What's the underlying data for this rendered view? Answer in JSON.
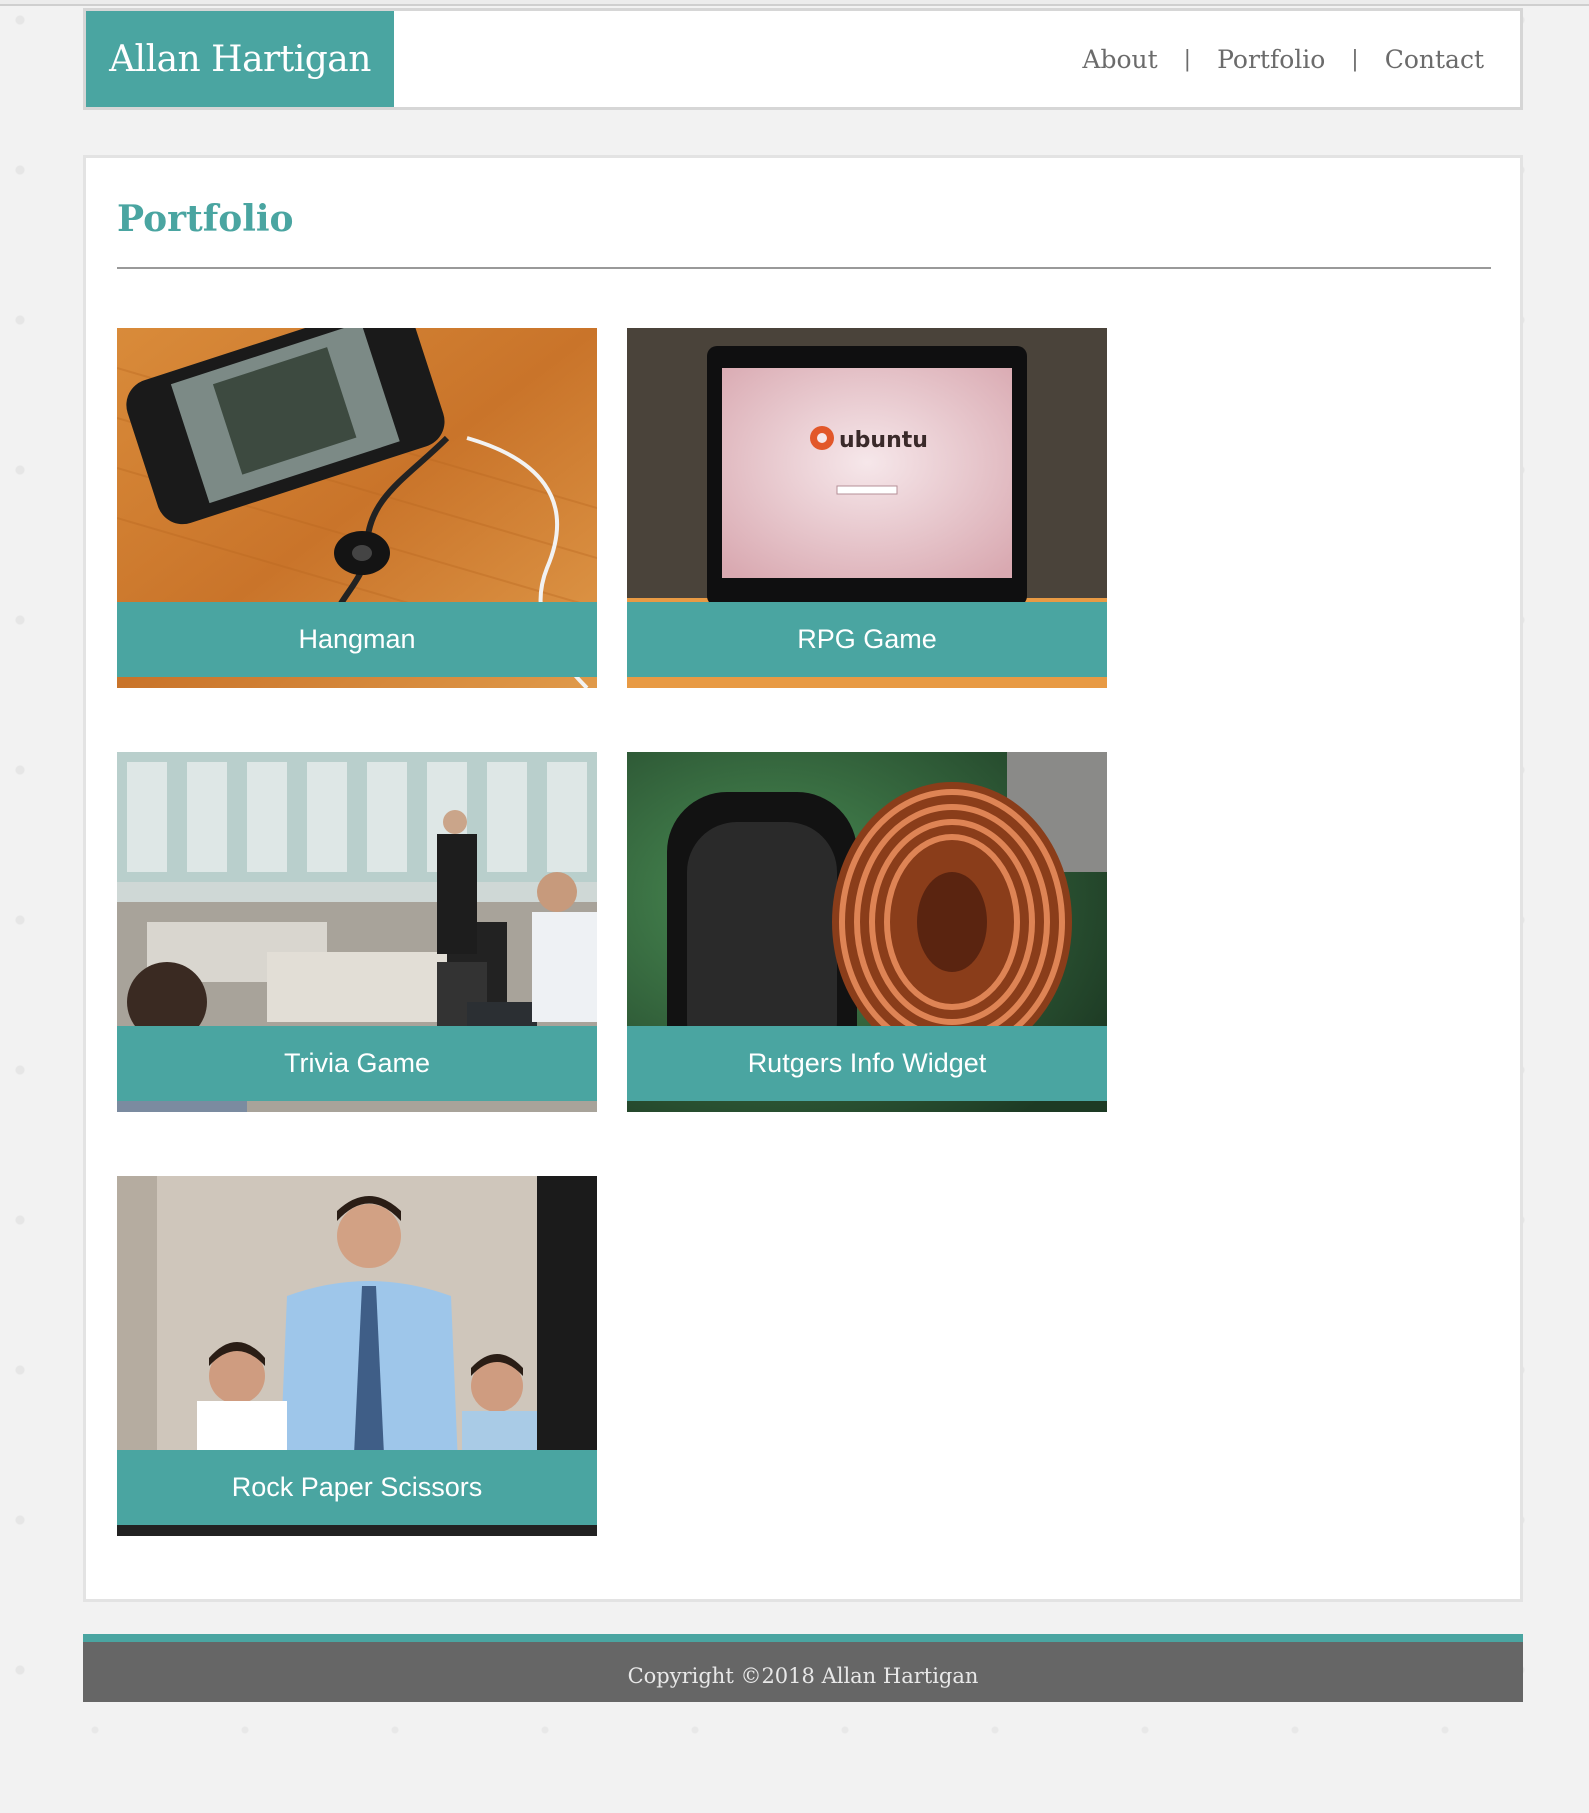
{
  "header": {
    "brand": "Allan Hartigan",
    "nav": [
      {
        "label": "About"
      },
      {
        "label": "Portfolio"
      },
      {
        "label": "Contact"
      }
    ],
    "separator": "|"
  },
  "main": {
    "title": "Portfolio",
    "projects": [
      {
        "caption": "Hangman",
        "image": "smartphone with earphones on wooden table"
      },
      {
        "caption": "RPG Game",
        "image": "laptop showing ubuntu login screen"
      },
      {
        "caption": "Trivia Game",
        "image": "office workers at desks"
      },
      {
        "caption": "Rutgers Info Widget",
        "image": "copper coil inductor on circuit board"
      },
      {
        "caption": "Rock Paper Scissors",
        "image": "businessman standing with two colleagues"
      }
    ],
    "image_text": "ubuntu"
  },
  "footer": {
    "copyright": "Copyright ©2018 Allan Hartigan"
  },
  "colors": {
    "accent": "#4aa5a1",
    "footer_bg": "#666666",
    "nav_text": "#6b6b6b"
  }
}
